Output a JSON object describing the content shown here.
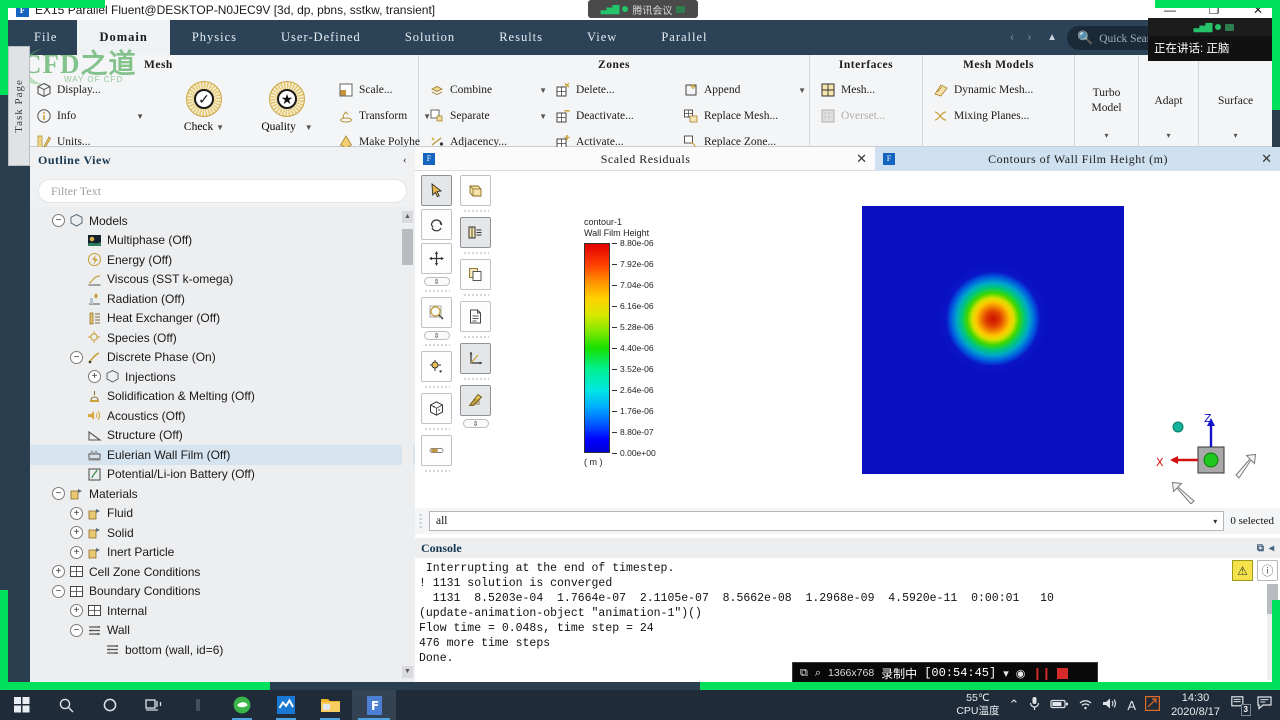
{
  "titlebar": {
    "icon": "fluent-app-icon",
    "text": "EX15 Parallel Fluent@DESKTOP-N0JEC9V  [3d, dp, pbns, sstkw, transient]",
    "minimize": "—",
    "maximize": "❐",
    "close": "✕"
  },
  "meeting_pill": {
    "bars": "▃▅▇",
    "label": "腾讯会议"
  },
  "speaking_tip": "正在讲话: 正脑",
  "ribbon": {
    "tabs": [
      {
        "label": "File",
        "active": false
      },
      {
        "label": "Domain",
        "active": true
      },
      {
        "label": "Physics",
        "active": false
      },
      {
        "label": "User-Defined",
        "active": false
      },
      {
        "label": "Solution",
        "active": false
      },
      {
        "label": "Results",
        "active": false
      },
      {
        "label": "View",
        "active": false
      },
      {
        "label": "Parallel",
        "active": false
      }
    ],
    "nav_prev": "‹",
    "nav_next": "›",
    "collapse_caret": "▲",
    "search_placeholder": "Quick Sear⋯",
    "help_label": "?",
    "panel_label": "panel-layout-icon"
  },
  "groups": {
    "mesh": {
      "title": "Mesh",
      "items": [
        {
          "label": "Display...",
          "icon": "cube-icon",
          "dropdown": false
        },
        {
          "label": "Info",
          "icon": "info-icon",
          "dropdown": true
        },
        {
          "label": "Units...",
          "icon": "units-icon",
          "dropdown": false
        },
        {
          "label": "Scale...",
          "icon": "scale-icon",
          "dropdown": false
        },
        {
          "label": "Transform",
          "icon": "transform-icon",
          "dropdown": true
        },
        {
          "label": "Make Polyhe",
          "icon": "polyhedra-icon",
          "dropdown": false
        }
      ],
      "check_label": "Check",
      "quality_label": "Quality"
    },
    "zones": {
      "title": "Zones",
      "col1": [
        {
          "label": "Combine",
          "icon": "combine-icon",
          "dropdown": true
        },
        {
          "label": "Separate",
          "icon": "separate-icon",
          "dropdown": true
        },
        {
          "label": "Adjacency...",
          "icon": "adjacency-icon",
          "dropdown": false
        }
      ],
      "col2": [
        {
          "label": "Delete...",
          "icon": "delete-zone-icon",
          "dropdown": false
        },
        {
          "label": "Deactivate...",
          "icon": "deactivate-zone-icon",
          "dropdown": false
        },
        {
          "label": "Activate...",
          "icon": "activate-zone-icon",
          "dropdown": false
        }
      ],
      "col3": [
        {
          "label": "Append",
          "icon": "append-icon",
          "dropdown": true
        },
        {
          "label": "Replace Mesh...",
          "icon": "replace-mesh-icon",
          "dropdown": false
        },
        {
          "label": "Replace Zone...",
          "icon": "replace-zone-icon",
          "dropdown": false
        }
      ]
    },
    "interfaces": {
      "title": "Interfaces",
      "items": [
        {
          "label": "Mesh...",
          "icon": "mesh-interface-icon",
          "disabled": false
        },
        {
          "label": "Overset...",
          "icon": "overset-icon",
          "disabled": true
        }
      ]
    },
    "mesh_models": {
      "title": "Mesh Models",
      "items": [
        {
          "label": "Dynamic Mesh...",
          "icon": "dynamic-mesh-icon"
        },
        {
          "label": "Mixing Planes...",
          "icon": "mixing-planes-icon"
        }
      ]
    },
    "turbo": {
      "line1": "Turbo",
      "line2": "Model",
      "caret": "▾"
    },
    "adapt": {
      "line1": "Adapt",
      "line2": "",
      "caret": "▾"
    },
    "surface": {
      "line1": "Surface",
      "line2": "",
      "caret": "▾"
    }
  },
  "watermark": {
    "main": "CFD之道",
    "sub": "WAY OF CFD"
  },
  "task_page_tab": "Task Page",
  "outline": {
    "title": "Outline View",
    "collapse_icon": "‹",
    "filter_placeholder": "Filter Text",
    "scroll_up": "▲",
    "scroll_down": "▼",
    "tree": [
      {
        "label": "Models",
        "indent": 0,
        "toggle": "minus",
        "icon": "models-icon",
        "selected": false
      },
      {
        "label": "Multiphase (Off)",
        "indent": 1,
        "toggle": "none",
        "icon": "multiphase-icon",
        "selected": false
      },
      {
        "label": "Energy (Off)",
        "indent": 1,
        "toggle": "none",
        "icon": "energy-icon",
        "selected": false
      },
      {
        "label": "Viscous (SST k-omega)",
        "indent": 1,
        "toggle": "none",
        "icon": "viscous-icon",
        "selected": false
      },
      {
        "label": "Radiation (Off)",
        "indent": 1,
        "toggle": "none",
        "icon": "radiation-icon",
        "selected": false
      },
      {
        "label": "Heat Exchanger (Off)",
        "indent": 1,
        "toggle": "none",
        "icon": "heat-exchanger-icon",
        "selected": false
      },
      {
        "label": "Species (Off)",
        "indent": 1,
        "toggle": "none",
        "icon": "species-icon",
        "selected": false
      },
      {
        "label": "Discrete Phase (On)",
        "indent": 1,
        "toggle": "minus",
        "icon": "discrete-phase-icon",
        "selected": false
      },
      {
        "label": "Injections",
        "indent": 2,
        "toggle": "plus",
        "icon": "injections-icon",
        "selected": false
      },
      {
        "label": "Solidification & Melting (Off)",
        "indent": 1,
        "toggle": "none",
        "icon": "solidification-icon",
        "selected": false
      },
      {
        "label": "Acoustics (Off)",
        "indent": 1,
        "toggle": "none",
        "icon": "acoustics-icon",
        "selected": false
      },
      {
        "label": "Structure (Off)",
        "indent": 1,
        "toggle": "none",
        "icon": "structure-icon",
        "selected": false
      },
      {
        "label": "Eulerian Wall Film (Off)",
        "indent": 1,
        "toggle": "none",
        "icon": "wall-film-icon",
        "selected": true
      },
      {
        "label": "Potential/Li-ion Battery (Off)",
        "indent": 1,
        "toggle": "none",
        "icon": "battery-icon",
        "selected": false
      },
      {
        "label": "Materials",
        "indent": 0,
        "toggle": "minus",
        "icon": "materials-icon",
        "selected": false
      },
      {
        "label": "Fluid",
        "indent": 1,
        "toggle": "plus",
        "icon": "materials-icon",
        "selected": false
      },
      {
        "label": "Solid",
        "indent": 1,
        "toggle": "plus",
        "icon": "materials-icon",
        "selected": false
      },
      {
        "label": "Inert Particle",
        "indent": 1,
        "toggle": "plus",
        "icon": "materials-icon",
        "selected": false
      },
      {
        "label": "Cell Zone Conditions",
        "indent": 0,
        "toggle": "plus",
        "icon": "zone-grid-icon",
        "selected": false
      },
      {
        "label": "Boundary Conditions",
        "indent": 0,
        "toggle": "minus",
        "icon": "zone-grid-icon",
        "selected": false
      },
      {
        "label": "Internal",
        "indent": 1,
        "toggle": "plus",
        "icon": "zone-grid-icon",
        "selected": false
      },
      {
        "label": "Wall",
        "indent": 1,
        "toggle": "minus",
        "icon": "wall-icon",
        "selected": false
      },
      {
        "label": "bottom (wall, id=6)",
        "indent": 2,
        "toggle": "none",
        "icon": "wall-icon",
        "selected": false
      }
    ]
  },
  "graphics": {
    "tabs": [
      {
        "label": "Scaled Residuals",
        "close": "✕",
        "active": false
      },
      {
        "label": "Contours of Wall Film Height (m)",
        "close": "✕",
        "active": true
      }
    ],
    "toolbar_left": [
      {
        "name": "select-pointer-tool",
        "glyph": "➤",
        "active": true
      },
      {
        "name": "rotate-view-tool",
        "glyph": "↻",
        "active": false
      },
      {
        "name": "pan-view-tool",
        "glyph": "✥",
        "active": false
      },
      {
        "name": "zoom-tool",
        "glyph": "⌕",
        "active": false
      },
      {
        "name": "probe-tool",
        "glyph": "⚙",
        "active": false
      },
      {
        "name": "view-cube-tool",
        "glyph": "❐",
        "active": false
      },
      {
        "name": "capsule-tool",
        "glyph": "▬",
        "active": false
      }
    ],
    "toolbar_right": [
      {
        "name": "render-view-tool",
        "glyph": "❑",
        "active": false
      },
      {
        "name": "lighting-tool",
        "glyph": "◨",
        "active": true
      },
      {
        "name": "copy-view-tool",
        "glyph": "❐",
        "active": false
      },
      {
        "name": "annotate-tool",
        "glyph": "≡",
        "active": false
      },
      {
        "name": "axes-tool",
        "glyph": "↗",
        "active": true
      },
      {
        "name": "colormap-tool",
        "glyph": "◤",
        "active": true
      }
    ]
  },
  "chart_data": {
    "type": "heatmap",
    "title": "contour-1",
    "subtitle": "Wall Film Height",
    "unit": "( m )",
    "colorbar_ticks": [
      "8.80e-06",
      "7.92e-06",
      "7.04e-06",
      "6.16e-06",
      "5.28e-06",
      "4.40e-06",
      "3.52e-06",
      "2.64e-06",
      "1.76e-06",
      "8.80e-07",
      "0.00e+00"
    ],
    "zlim": [
      0,
      8.8e-06
    ],
    "colormap": "rainbow-jet",
    "field": "Wall Film Height",
    "field_unit": "m",
    "background": "#0a10c2",
    "peak_value": 8.8e-06,
    "peak_location": "center",
    "description": "Axisymmetric circular film-height hotspot centered on a square wall patch; value decays radially from peak (red) to 0 (dark blue) at the domain edges."
  },
  "axis_triad": {
    "x_label": "X",
    "z_label": "Z"
  },
  "surface_row": {
    "selected": "all",
    "caret": "▾",
    "count_label": "0 selected"
  },
  "console": {
    "title": "Console",
    "ctrl_undock": "⧉",
    "ctrl_collapse": "◂",
    "warn_icon": "⚠",
    "info_icon": "ⓘ",
    "lines": [
      " Interrupting at the end of timestep.",
      "! 1131 solution is converged",
      "  1131  8.5203e-04  1.7664e-07  2.1105e-07  8.5662e-08  1.2968e-09  4.5920e-11  0:00:01   10",
      "(update-animation-object \"animation-1\")()",
      "Flow time = 0.048s, time step = 24",
      "476 more time steps",
      "Done."
    ]
  },
  "recorder": {
    "window_icon": "⧉",
    "zoom_icon": "⌕",
    "resolution": "1366x768",
    "status": "录制中",
    "elapsed": "[00:54:45]",
    "caret": "▾",
    "camera_icon": "◉",
    "pause_icon": "❙❙",
    "stop_icon": "stop-square"
  },
  "taskbar": {
    "items": [
      {
        "name": "start-button",
        "glyph": "windows-logo"
      },
      {
        "name": "search-button",
        "glyph": "⌕"
      },
      {
        "name": "cortana-button",
        "glyph": "○"
      },
      {
        "name": "task-view-button",
        "glyph": "⧉"
      },
      {
        "name": "divider",
        "glyph": "❘"
      },
      {
        "name": "browser-app",
        "glyph": "e"
      },
      {
        "name": "chart-app",
        "glyph": "〰"
      },
      {
        "name": "file-explorer-app",
        "glyph": "▬"
      },
      {
        "name": "fluent-app",
        "glyph": "F"
      }
    ],
    "cpu_temp": "55℃",
    "cpu_label": "CPU温度",
    "tray": [
      "˄",
      "Ψ",
      "▭",
      "◕",
      "◂))",
      "A",
      "⟋"
    ],
    "time": "14:30",
    "date": "2020/8/17",
    "notify_count": "3"
  }
}
